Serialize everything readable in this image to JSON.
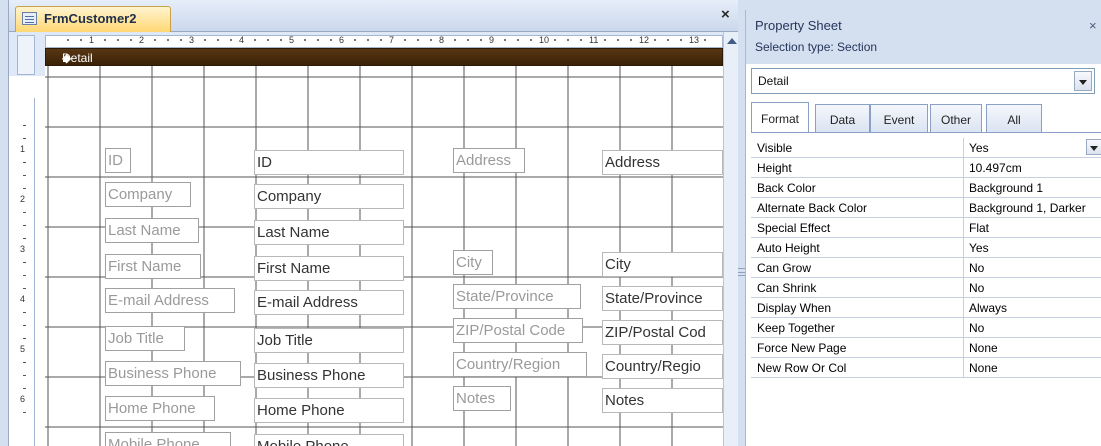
{
  "form": {
    "tab_title": "FrmCustomer2",
    "close_glyph": "×",
    "section_name": "Detail",
    "section_glyph": "◆",
    "ruler_numbers": [
      "1",
      "2",
      "3",
      "4",
      "5",
      "6",
      "7",
      "8",
      "9",
      "10",
      "11",
      "12",
      "13"
    ],
    "vruler_numbers": [
      "1",
      "2",
      "3",
      "4",
      "5",
      "6"
    ],
    "labels_col1": [
      "ID",
      "Company",
      "Last Name",
      "First Name",
      "E-mail Address",
      "Job Title",
      "Business Phone",
      "Home Phone",
      "Mobile Phone"
    ],
    "fields_col1": [
      "ID",
      "Company",
      "Last Name",
      "First Name",
      "E-mail Address",
      "Job Title",
      "Business Phone",
      "Home Phone",
      "Mobile Phone"
    ],
    "labels_col2": [
      "Address",
      "City",
      "State/Province",
      "ZIP/Postal Code",
      "Country/Region",
      "Notes"
    ],
    "fields_col2": [
      "Address",
      "City",
      "State/Province",
      "ZIP/Postal Cod",
      "Country/Regio",
      "Notes"
    ]
  },
  "property_sheet": {
    "title": "Property Sheet",
    "close_glyph": "×",
    "selection_type": "Selection type:  Section",
    "selected_object": "Detail",
    "tabs": [
      "Format",
      "Data",
      "Event",
      "Other",
      "All"
    ],
    "active_tab": "Format",
    "rows": [
      {
        "name": "Visible",
        "value": "Yes"
      },
      {
        "name": "Height",
        "value": "10.497cm"
      },
      {
        "name": "Back Color",
        "value": "Background 1"
      },
      {
        "name": "Alternate Back Color",
        "value": "Background 1, Darker"
      },
      {
        "name": "Special Effect",
        "value": "Flat"
      },
      {
        "name": "Auto Height",
        "value": "Yes"
      },
      {
        "name": "Can Grow",
        "value": "No"
      },
      {
        "name": "Can Shrink",
        "value": "No"
      },
      {
        "name": "Display When",
        "value": "Always"
      },
      {
        "name": "Keep Together",
        "value": "No"
      },
      {
        "name": "Force New Page",
        "value": "None"
      },
      {
        "name": "New Row Or Col",
        "value": "None"
      }
    ]
  },
  "colors": {
    "section_bar": "#4a2c0c",
    "tab_active": "#ffd774",
    "chrome": "#d4dff0"
  }
}
